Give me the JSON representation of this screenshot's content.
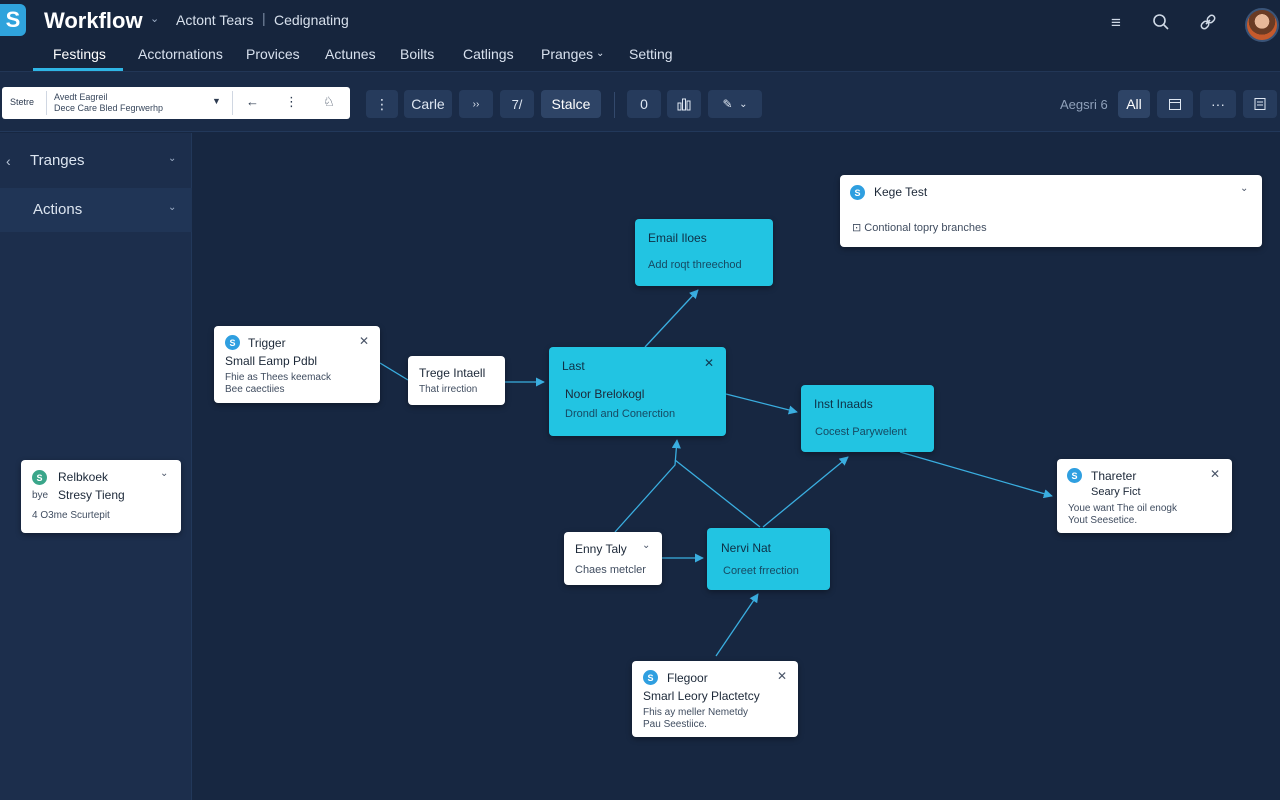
{
  "header": {
    "logo_glyph": "S",
    "app_title": "Workflow",
    "breadcrumbs": [
      "Actont Tears",
      "Cedignating"
    ],
    "breadcrumb_separator": "|",
    "tabs": [
      {
        "label": "Festings",
        "active": true
      },
      {
        "label": "Acctornations"
      },
      {
        "label": "Provices"
      },
      {
        "label": "Actunes"
      },
      {
        "label": "Boilts"
      },
      {
        "label": "Catlings"
      },
      {
        "label": "Pranges"
      },
      {
        "label": "Setting"
      }
    ]
  },
  "toolbar": {
    "search_label": "Stetre",
    "search_line1": "Avedt Eagreil",
    "search_line2": "Dece Care Bled Fegrwerhp",
    "cards_button": "Carle",
    "count_button": "7/",
    "stalce_button": "Stalce",
    "zero_button": "0",
    "zoom_text": "Aegsri 6",
    "all_button": "All"
  },
  "sidebar": {
    "items": [
      {
        "label": "Tranges"
      },
      {
        "label": "Actions",
        "active": true
      }
    ]
  },
  "nodes": {
    "trigger": {
      "badge": "S",
      "title": "Trigger",
      "subtitle": "Small Eamp Pdbl",
      "desc1": "Fhie as Thees keemack",
      "desc2": "Bee caectiies"
    },
    "trege": {
      "title": "Trege Intaell",
      "desc": "That irrection"
    },
    "last": {
      "title": "Last",
      "subtitle": "Noor Brelokogl",
      "desc": "Drondl and Conerction"
    },
    "email": {
      "title": "Email Iloes",
      "desc": "Add roqt threechod"
    },
    "inst": {
      "title": "Inst Inaads",
      "desc": "Cocest Parywelent"
    },
    "kege": {
      "badge": "S",
      "title": "Kege Test",
      "desc": "Contional topry branches"
    },
    "thareter": {
      "badge": "S",
      "title": "Thareter",
      "subtitle": "Seary Fict",
      "desc1": "Youe want The oil enogk",
      "desc2": "Yout Seesetice."
    },
    "relbkoek": {
      "badge": "S",
      "title": "Relbkoek",
      "subtitle_prefix": "bye",
      "subtitle": "Stresy Tieng",
      "desc": "4 O3me Scurtepit"
    },
    "entry": {
      "title": "Enny Taly",
      "desc": "Chaes metcler"
    },
    "nervi": {
      "title": "Nervi Nat",
      "desc": "Coreet frrection"
    },
    "flegoor": {
      "badge": "S",
      "title": "Flegoor",
      "subtitle": "Smarl Leory Plactetcy",
      "desc1": "Fhis ay meller Nemetdy",
      "desc2": "Pau Seestiice."
    }
  },
  "colors": {
    "background": "#172741",
    "accent": "#2fb6e6",
    "node_cyan": "#22c4e2",
    "edge": "#3aaee0"
  }
}
